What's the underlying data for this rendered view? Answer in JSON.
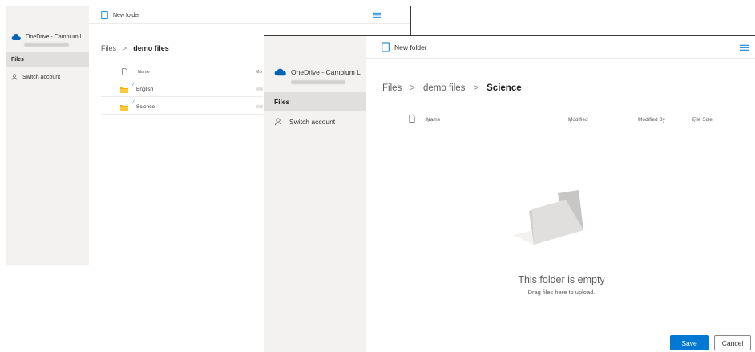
{
  "back_window": {
    "command_bar": {
      "new_folder_label": "New folder"
    },
    "sidebar": {
      "account_name": "OneDrive - Cambium L",
      "items": [
        {
          "label": "Files"
        },
        {
          "label": "Switch account"
        }
      ]
    },
    "breadcrumb": {
      "root": "Files",
      "separator": ">",
      "current": "demo files"
    },
    "list_header": {
      "name": "Name",
      "modified": "Mo"
    },
    "rows": [
      {
        "name": "English"
      },
      {
        "name": "Science"
      }
    ]
  },
  "front_window": {
    "command_bar": {
      "new_folder_label": "New folder"
    },
    "sidebar": {
      "account_name": "OneDrive - Cambium L",
      "items": [
        {
          "label": "Files"
        },
        {
          "label": "Switch account"
        }
      ]
    },
    "breadcrumb": {
      "root": "Files",
      "separator": ">",
      "middle": "demo files",
      "current": "Science"
    },
    "list_header": {
      "name": "Name",
      "modified": "Modified",
      "modified_by": "Modified By",
      "file_size": "File Size"
    },
    "empty_state": {
      "title": "This folder is empty",
      "subtitle": "Drag files here to upload."
    },
    "footer": {
      "save_label": "Save",
      "cancel_label": "Cancel"
    }
  },
  "icons": {
    "cloud": "onedrive-cloud-icon",
    "folder": "folder-icon",
    "new_folder": "new-folder-icon",
    "menu": "menu-lines-icon",
    "person": "person-icon",
    "file": "file-type-icon",
    "sync": "sync-status-icon",
    "chevron": "chevron-down-icon"
  },
  "colors": {
    "accent": "#0078d4",
    "folder": "#f2b600",
    "sidebar_bg": "#f3f2f1",
    "selected_nav_bg": "#e1dfdd"
  }
}
